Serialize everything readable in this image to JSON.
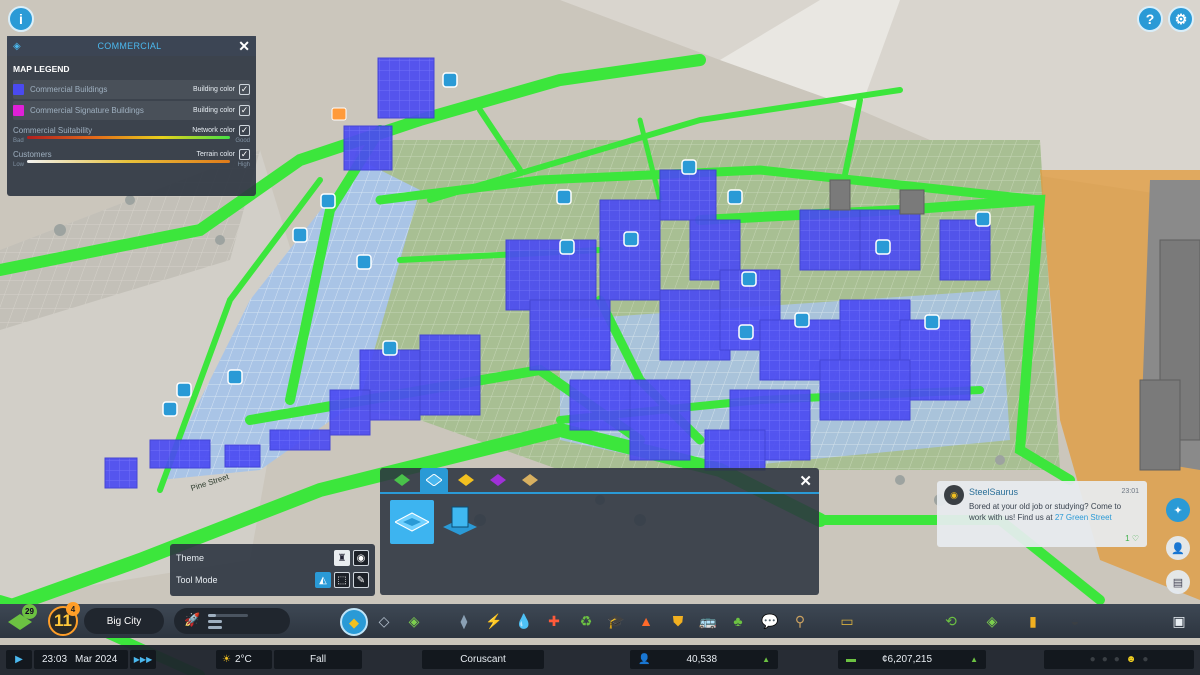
{
  "top_buttons": {
    "info": "i",
    "help": "?"
  },
  "legend": {
    "title": "COMMERCIAL",
    "section": "MAP LEGEND",
    "rows": [
      {
        "label": "Commercial Buildings",
        "option": "Building color",
        "color": "#4a4af0",
        "checked": true
      },
      {
        "label": "Commercial Signature Buildings",
        "option": "Building color",
        "color": "#e020d8",
        "checked": true
      }
    ],
    "gradients": [
      {
        "label": "Commercial Suitability",
        "option": "Network color",
        "low": "Bad",
        "high": "Good",
        "checked": true
      },
      {
        "label": "Customers",
        "option": "Terrain color",
        "low": "Low",
        "high": "High",
        "checked": true
      }
    ]
  },
  "street_labels": [
    "Pine Street"
  ],
  "tool_panel": {
    "theme_label": "Theme",
    "tool_mode_label": "Tool Mode"
  },
  "chirp": {
    "user": "SteelSaurus",
    "time": "23:01",
    "message": "Bored at your old job or studying? Come to work with us! Find us at ",
    "link": "27 Green Street",
    "likes": "1"
  },
  "toolbar": {
    "development_points": "29",
    "level": "11",
    "level_badge": "4",
    "city_name": "Big City",
    "milestone_progress": [
      0.2,
      0.1,
      0.1
    ],
    "tools": [
      "zoning-icon",
      "roads-icon",
      "areas-icon",
      "transport-icon",
      "electricity-icon",
      "water-icon",
      "healthcare-icon",
      "garbage-icon",
      "education-icon",
      "fire-icon",
      "police-icon",
      "public-transport-icon",
      "parks-icon",
      "communications-icon",
      "landscaping-icon",
      "signature-icon"
    ],
    "right_tools": [
      "budget-icon",
      "map-icon",
      "stats-icon",
      "advisor-icon"
    ]
  },
  "status": {
    "time": "23:03",
    "date": "Mar 2024",
    "temperature": "2°C",
    "season": "Fall",
    "city_name": "Coruscant",
    "population": "40,538",
    "money": "¢6,207,215"
  },
  "colors": {
    "accent": "#2a9ad6",
    "network_green": "#3ce63c",
    "commercial": "#4a4af0"
  }
}
